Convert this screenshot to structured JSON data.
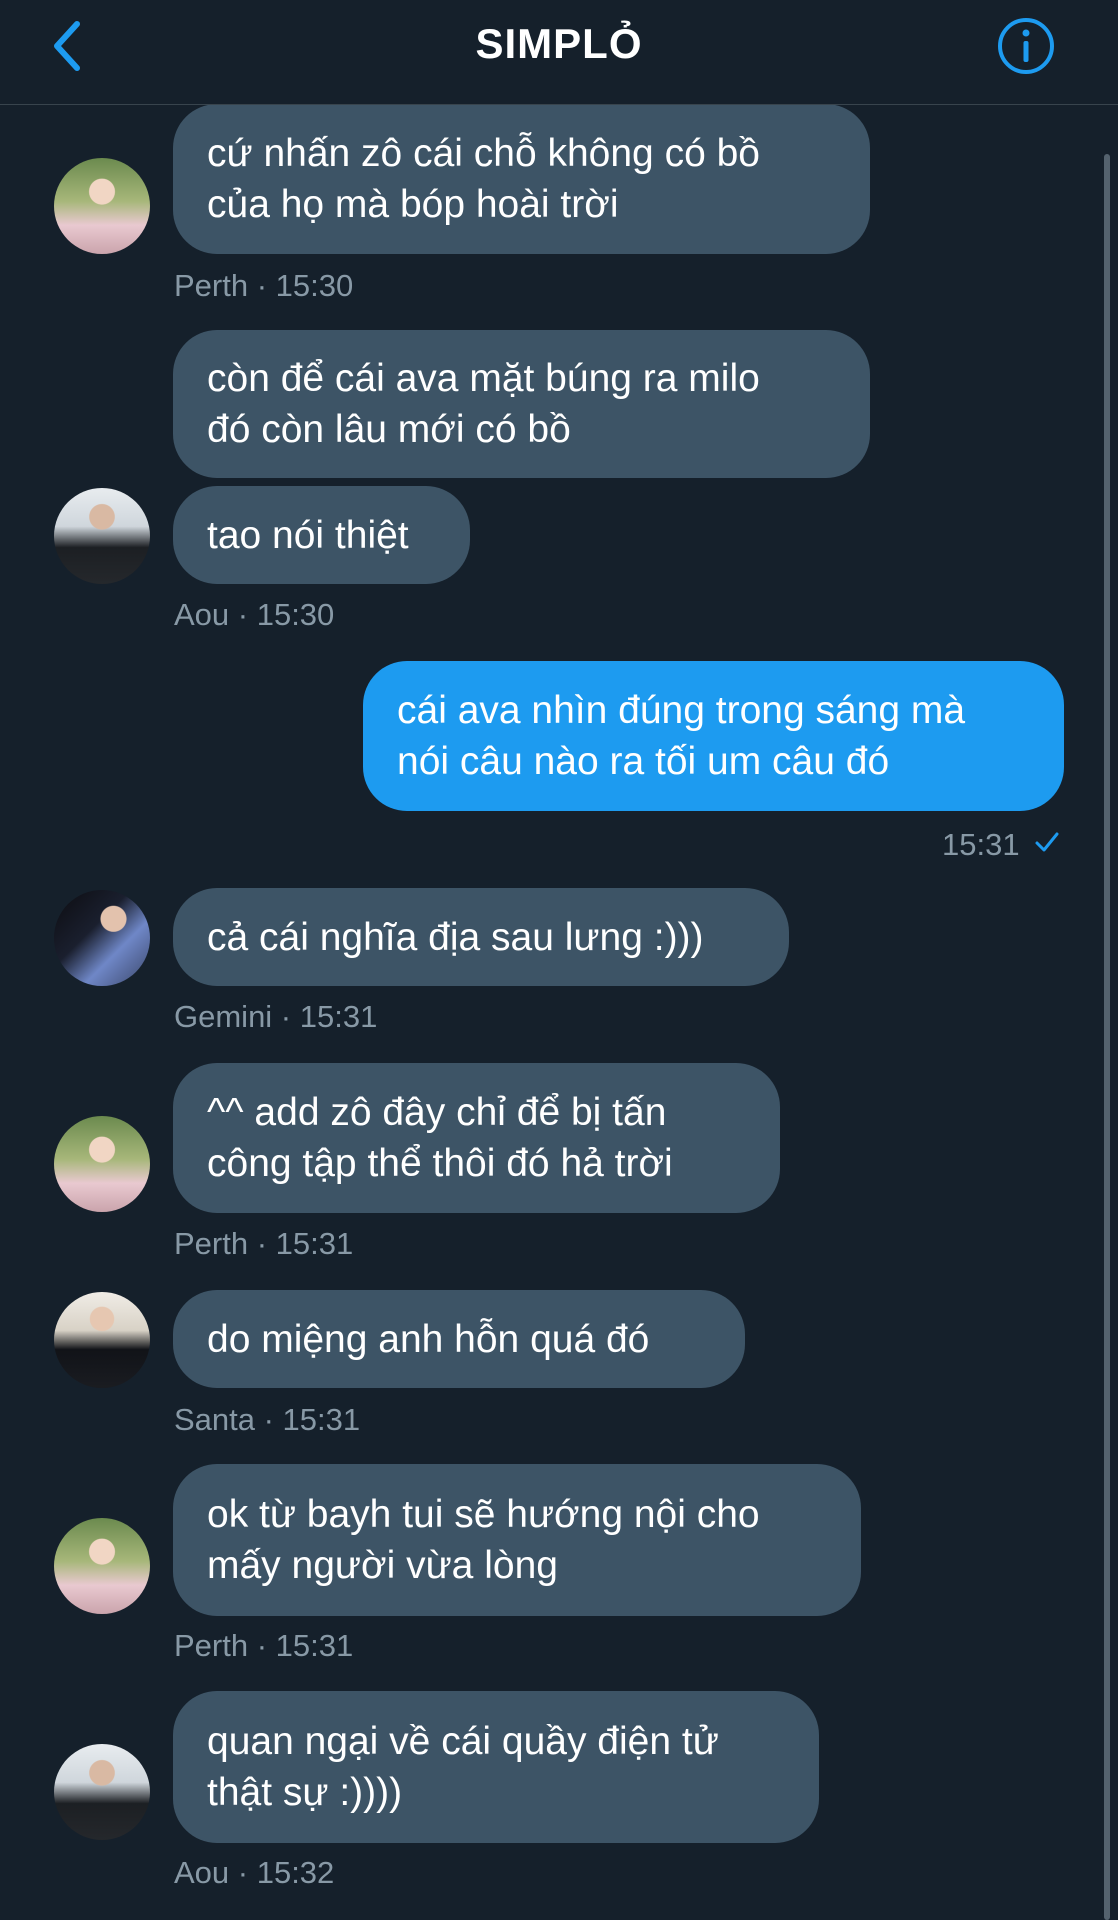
{
  "header": {
    "title": "SIMPLỎ",
    "back_icon": "chevron-left-icon",
    "info_icon": "info-circle-icon",
    "accent_color": "#1d9bf0"
  },
  "messages": [
    {
      "sender": "Perth",
      "lines": [
        "cứ nhấn zô cái chỗ không có bồ",
        "của họ mà bóp hoài trời"
      ],
      "meta": "Perth · 15:30"
    },
    {
      "sender": "Aou",
      "lines": [
        "còn để cái ava mặt búng ra milo",
        "đó còn lâu mới có bồ"
      ]
    },
    {
      "sender": "Aou",
      "lines": [
        "tao nói thiệt"
      ],
      "meta": "Aou · 15:30"
    },
    {
      "sender": "me",
      "lines": [
        "cái ava nhìn đúng trong sáng mà",
        "nói câu nào ra tối um câu đó"
      ],
      "meta": "15:31",
      "status_icon": "checkmark-icon"
    },
    {
      "sender": "Gemini",
      "lines": [
        "cả cái nghĩa địa sau lưng :)))"
      ],
      "meta": "Gemini · 15:31"
    },
    {
      "sender": "Perth",
      "lines": [
        "^^ add zô đây chỉ để bị tấn",
        "công tập thể thôi đó hả trời"
      ],
      "meta": "Perth · 15:31"
    },
    {
      "sender": "Santa",
      "lines": [
        "do miệng anh hỗn quá đó"
      ],
      "meta": "Santa · 15:31"
    },
    {
      "sender": "Perth",
      "lines": [
        "ok từ bayh tui sẽ hướng nội cho",
        "mấy người vừa lòng"
      ],
      "meta": "Perth · 15:31"
    },
    {
      "sender": "Aou",
      "lines": [
        "quan ngại về cái quầy điện tử",
        "thật sự :))))"
      ],
      "meta": "Aou · 15:32"
    }
  ],
  "colors": {
    "background": "#15202b",
    "incoming_bubble": "#3d5466",
    "outgoing_bubble": "#1d9bf0",
    "meta_text": "#8899a6"
  }
}
